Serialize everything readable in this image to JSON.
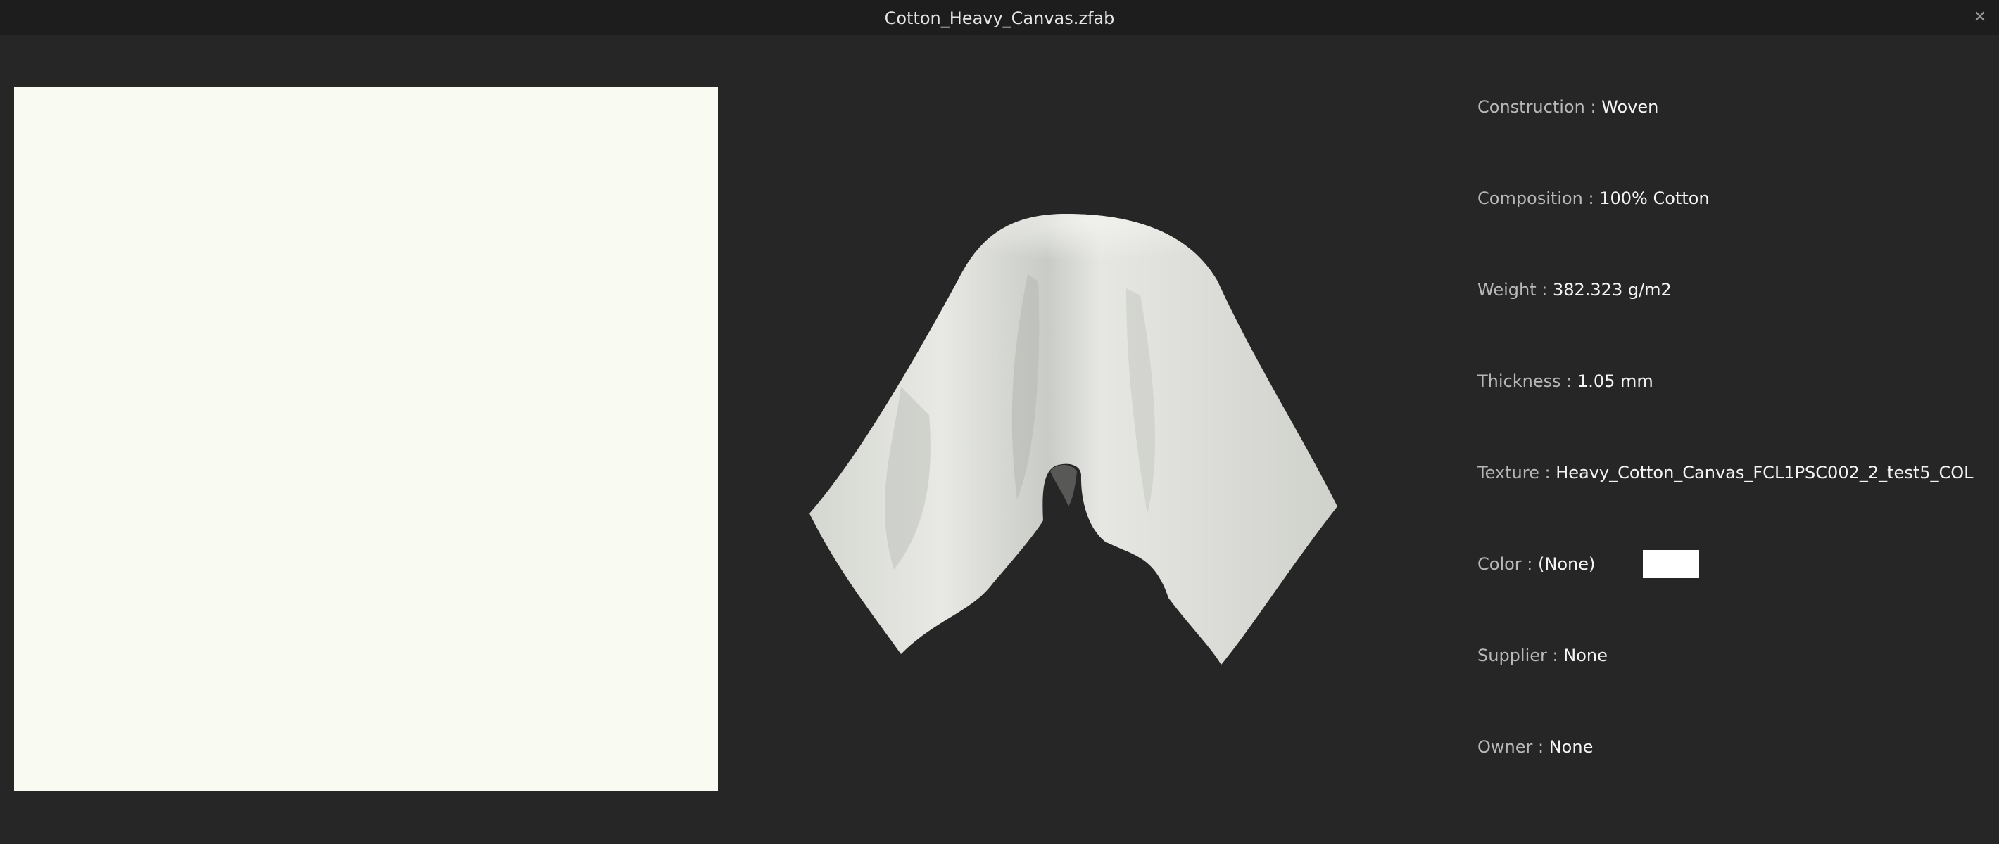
{
  "window": {
    "title": "Cotton_Heavy_Canvas.zfab",
    "close_glyph": "✕"
  },
  "properties": [
    {
      "label": "Construction",
      "sep": " : ",
      "value": "Woven"
    },
    {
      "label": "Composition",
      "sep": " : ",
      "value": "100% Cotton"
    },
    {
      "label": "Weight",
      "sep": " : ",
      "value": "382.323 g/m2"
    },
    {
      "label": "Thickness",
      "sep": " : ",
      "value": "1.05 mm"
    },
    {
      "label": "Texture",
      "sep": " : ",
      "value": "Heavy_Cotton_Canvas_FCL1PSC002_2_test5_COL"
    },
    {
      "label": "Color",
      "sep": " : ",
      "value": "(None)"
    },
    {
      "label": "Supplier",
      "sep": " : ",
      "value": "None"
    },
    {
      "label": "Owner",
      "sep": " : ",
      "value": "None"
    }
  ],
  "colors": {
    "background": "#262626",
    "titlebar": "#1d1d1d",
    "swatch": "#f9faf1",
    "fabric": "#e6e7e2",
    "color_chip": "#ffffff"
  }
}
